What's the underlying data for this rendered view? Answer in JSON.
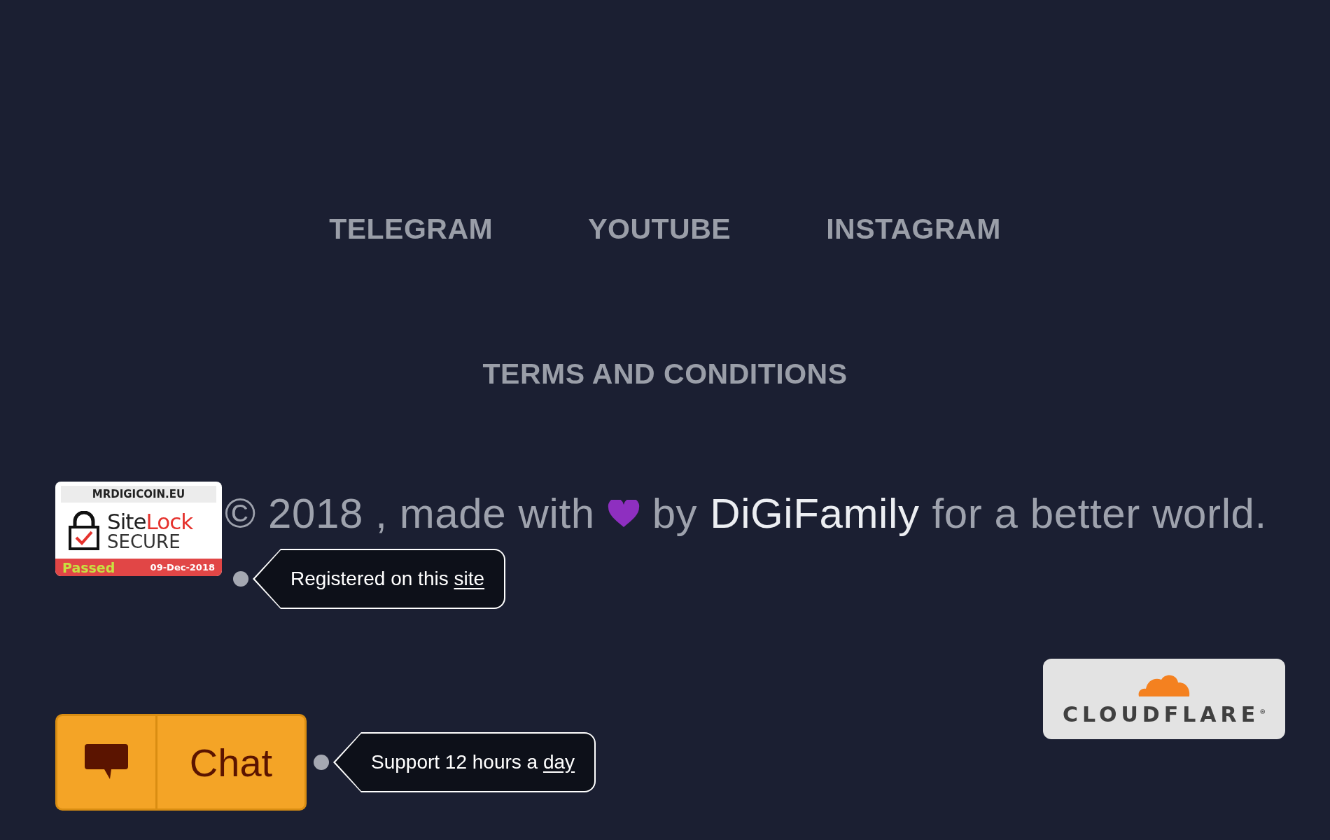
{
  "nav_links": [
    "TELEGRAM",
    "YOUTUBE",
    "INSTAGRAM"
  ],
  "terms_link": "TERMS AND CONDITIONS",
  "sitelock_badge": {
    "domain": "MRDIGICOIN.EU",
    "brand_first": "Site",
    "brand_second": "Lock",
    "secure": "SECURE",
    "status": "Passed",
    "date": "09-Dec-2018"
  },
  "copyright": {
    "before": "© 2018 , made with",
    "by": "by",
    "author": "DiGiFamily",
    "after": "for a better world."
  },
  "badge_tooltip": {
    "text": "Registered on this",
    "link": "site"
  },
  "chat_button": {
    "label": "Chat"
  },
  "chat_tooltip": {
    "text": "Support 12 hours a",
    "link": "day"
  },
  "cloudflare_badge": {
    "label": "CLOUDFLARE$^{®}$"
  }
}
